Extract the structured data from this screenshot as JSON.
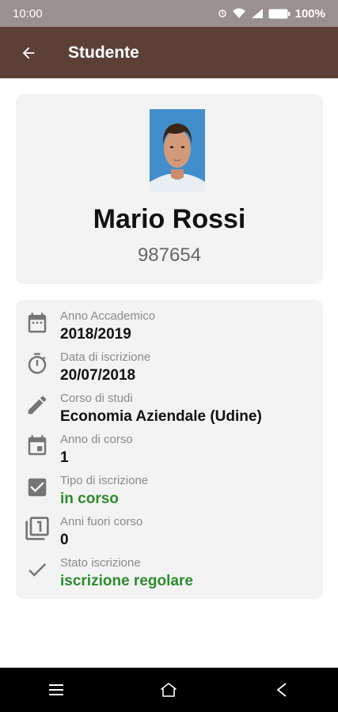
{
  "status_bar": {
    "time": "10:00",
    "battery": "100%"
  },
  "app_bar": {
    "title": "Studente"
  },
  "profile": {
    "name": "Mario Rossi",
    "id": "987654"
  },
  "details": [
    {
      "icon": "calendar-icon",
      "label": "Anno Accademico",
      "value": "2018/2019",
      "highlight": false
    },
    {
      "icon": "timer-icon",
      "label": "Data di iscrizione",
      "value": "20/07/2018",
      "highlight": false
    },
    {
      "icon": "pencil-icon",
      "label": "Corso di studi",
      "value": "Economia Aziendale (Udine)",
      "highlight": false
    },
    {
      "icon": "event-icon",
      "label": "Anno di corso",
      "value": "1",
      "highlight": false
    },
    {
      "icon": "checkbox-icon",
      "label": "Tipo di iscrizione",
      "value": "in corso",
      "highlight": true
    },
    {
      "icon": "library-one-icon",
      "label": "Anni fuori corso",
      "value": "0",
      "highlight": false
    },
    {
      "icon": "check-icon",
      "label": "Stato iscrizione",
      "value": "iscrizione regolare",
      "highlight": true
    }
  ],
  "colors": {
    "app_bar": "#5c4038",
    "status_bar": "#9a9090",
    "card": "#f3f3f3",
    "green": "#2e8b2e",
    "icon": "#757575"
  }
}
